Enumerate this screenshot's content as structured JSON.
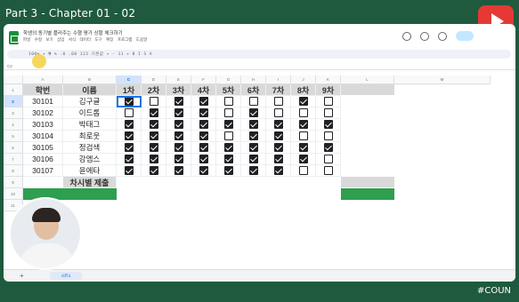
{
  "video": {
    "title": "Part 3 - Chapter 01 - 02",
    "hashtag": "#COUN",
    "logo_icon": "youtube-play-icon"
  },
  "sheet": {
    "doc_title": "학생의 동기별 플러주는 수행 평가 상황 체크하기",
    "menu": "파일 수정 보기 삽입 서식 데이터 도구 확장 프로그램 도움말",
    "toolbar_text": "100% ▾  ₩  %  .0  .00  123  기본값 ▾  -  11  +  B  I  S  A",
    "namebox": "C2",
    "columns": [
      "A",
      "B",
      "C",
      "D",
      "E",
      "F",
      "G",
      "H",
      "I",
      "J",
      "K",
      "L",
      "M"
    ],
    "selected_column": "C",
    "row_numbers": [
      "1",
      "2",
      "3",
      "4",
      "5",
      "6",
      "7",
      "8",
      "9",
      "10",
      "11"
    ],
    "selected_row": "2",
    "headers": [
      "학번",
      "이름",
      "1차",
      "2차",
      "3차",
      "4차",
      "5차",
      "6차",
      "7차",
      "8차",
      "9차"
    ],
    "students": [
      {
        "id": "30101",
        "name": "김구글",
        "checks": [
          true,
          false,
          true,
          true,
          false,
          false,
          false,
          true,
          false
        ]
      },
      {
        "id": "30102",
        "name": "이드롭",
        "checks": [
          false,
          true,
          true,
          true,
          false,
          true,
          false,
          false,
          false
        ]
      },
      {
        "id": "30103",
        "name": "박태그",
        "checks": [
          true,
          true,
          true,
          true,
          true,
          true,
          true,
          true,
          true
        ]
      },
      {
        "id": "30104",
        "name": "최로웃",
        "checks": [
          true,
          true,
          true,
          true,
          false,
          true,
          true,
          false,
          false
        ]
      },
      {
        "id": "30105",
        "name": "정검색",
        "checks": [
          true,
          true,
          true,
          true,
          true,
          true,
          true,
          true,
          true
        ]
      },
      {
        "id": "30106",
        "name": "강엠스",
        "checks": [
          true,
          true,
          true,
          true,
          true,
          true,
          true,
          true,
          false
        ]
      },
      {
        "id": "30107",
        "name": "윤에타",
        "checks": [
          true,
          true,
          true,
          true,
          true,
          true,
          true,
          false,
          false
        ]
      }
    ],
    "summary_label": "차시별 제출",
    "sheet_tab": "시트1"
  },
  "colors": {
    "frame": "#1f5a3e",
    "header_fill": "#d9d9d9",
    "summary_green": "#2e9e4f",
    "selection": "#1a73e8"
  }
}
